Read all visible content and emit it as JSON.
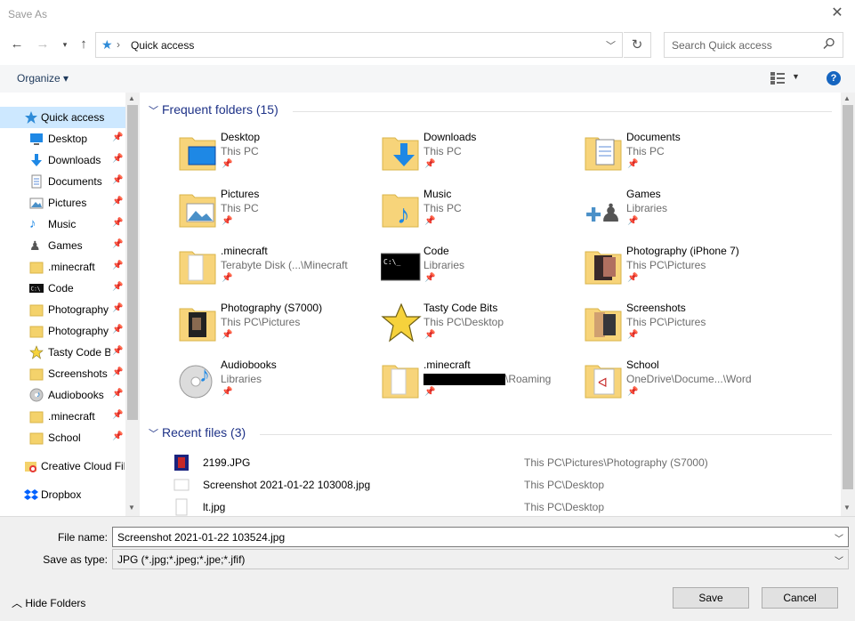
{
  "window": {
    "title": "Save As",
    "close_glyph": "✕"
  },
  "address": {
    "path": "Quick access",
    "separator": "›",
    "search_placeholder": "Search Quick access"
  },
  "toolbar": {
    "organize": "Organize ▾",
    "help": "?"
  },
  "nav": {
    "items": [
      {
        "label": "Quick access",
        "icon": "quick-access-star-icon",
        "pinned": false
      },
      {
        "label": "Desktop",
        "icon": "desktop-icon",
        "pinned": true
      },
      {
        "label": "Downloads",
        "icon": "downloads-arrow-icon",
        "pinned": true
      },
      {
        "label": "Documents",
        "icon": "documents-icon",
        "pinned": true
      },
      {
        "label": "Pictures",
        "icon": "pictures-icon",
        "pinned": true
      },
      {
        "label": "Music",
        "icon": "music-note-icon",
        "pinned": true
      },
      {
        "label": "Games",
        "icon": "games-icon",
        "pinned": true
      },
      {
        "label": ".minecraft",
        "icon": "folder-icon",
        "pinned": true
      },
      {
        "label": "Code",
        "icon": "console-icon",
        "pinned": true
      },
      {
        "label": "Photography",
        "icon": "folder-icon",
        "pinned": true
      },
      {
        "label": "Photography",
        "icon": "folder-icon",
        "pinned": true
      },
      {
        "label": "Tasty Code Bi",
        "icon": "star-icon",
        "pinned": true
      },
      {
        "label": "Screenshots",
        "icon": "folder-icon",
        "pinned": true
      },
      {
        "label": "Audiobooks",
        "icon": "audio-disc-icon",
        "pinned": true
      },
      {
        "label": ".minecraft",
        "icon": "folder-icon",
        "pinned": true
      },
      {
        "label": "School",
        "icon": "folder-icon",
        "pinned": true
      },
      {
        "label": "Creative Cloud Fil",
        "icon": "creative-cloud-icon",
        "pinned": false
      },
      {
        "label": "Dropbox",
        "icon": "dropbox-icon",
        "pinned": false
      }
    ]
  },
  "frequent": {
    "header": "Frequent folders (15)",
    "items": [
      {
        "name": "Desktop",
        "location": "This PC",
        "icon": "desktop-folder-icon"
      },
      {
        "name": "Downloads",
        "location": "This PC",
        "icon": "downloads-folder-icon"
      },
      {
        "name": "Documents",
        "location": "This PC",
        "icon": "documents-folder-icon"
      },
      {
        "name": "Pictures",
        "location": "This PC",
        "icon": "pictures-folder-icon"
      },
      {
        "name": "Music",
        "location": "This PC",
        "icon": "music-folder-icon"
      },
      {
        "name": "Games",
        "location": "Libraries",
        "icon": "games-library-icon"
      },
      {
        "name": ".minecraft",
        "location": "Terabyte Disk (...\\Minecraft",
        "icon": "folder-icon"
      },
      {
        "name": "Code",
        "location": "Libraries",
        "icon": "console-library-icon"
      },
      {
        "name": "Photography (iPhone 7)",
        "location": "This PC\\Pictures",
        "icon": "photo-folder-icon"
      },
      {
        "name": "Photography (S7000)",
        "location": "This PC\\Pictures",
        "icon": "photo-folder-icon"
      },
      {
        "name": "Tasty Code Bits",
        "location": "This PC\\Desktop",
        "icon": "star-folder-icon"
      },
      {
        "name": "Screenshots",
        "location": "This PC\\Pictures",
        "icon": "photo-folder-icon"
      },
      {
        "name": "Audiobooks",
        "location": "Libraries",
        "icon": "audio-library-icon"
      },
      {
        "name": ".minecraft",
        "location": "\\Roaming",
        "icon": "folder-icon",
        "redacted": true
      },
      {
        "name": "School",
        "location": "OneDrive\\Docume...\\Word",
        "icon": "document-folder-icon"
      }
    ]
  },
  "recent": {
    "header": "Recent files (3)",
    "items": [
      {
        "name": "2199.JPG",
        "path": "This PC\\Pictures\\Photography (S7000)",
        "icon": "photo-thumbnail-icon"
      },
      {
        "name": "Screenshot 2021-01-22 103008.jpg",
        "path": "This PC\\Desktop",
        "icon": "image-file-icon"
      },
      {
        "name": "lt.jpg",
        "path": "This PC\\Desktop",
        "icon": "image-file-icon"
      }
    ]
  },
  "form": {
    "filename_label": "File name:",
    "filename_value": "Screenshot 2021-01-22 103524.jpg",
    "type_label": "Save as type:",
    "type_value": "JPG (*.jpg;*.jpeg;*.jpe;*.jfif)",
    "hide_folders": "Hide Folders",
    "save": "Save",
    "cancel": "Cancel"
  },
  "colors": {
    "accent": "#1e3287",
    "selection": "#cde8ff",
    "folder": "#f4c542"
  }
}
